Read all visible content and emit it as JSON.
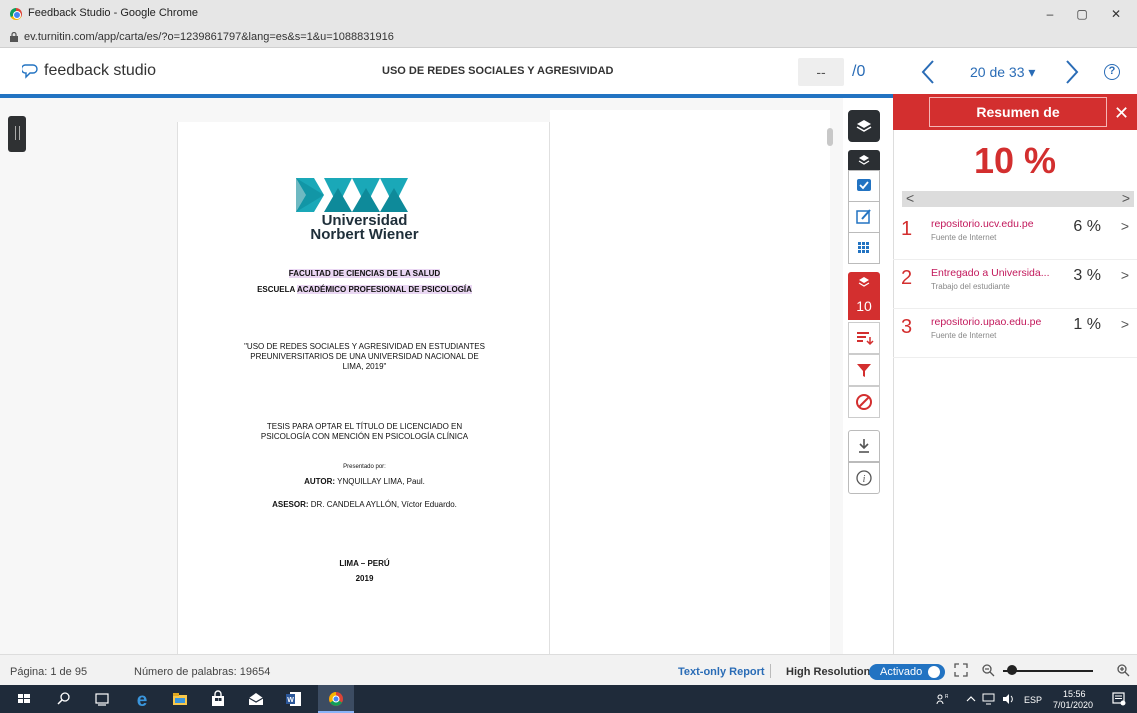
{
  "browser": {
    "window_title": "Feedback Studio - Google Chrome",
    "url": "ev.turnitin.com/app/carta/es/?o=1239861797&lang=es&s=1&u=1088831916",
    "minimize": "–",
    "maximize": "▢",
    "close": "✕"
  },
  "header": {
    "brand": "feedback studio",
    "document_title": "USO DE REDES SOCIALES Y AGRESIVIDAD",
    "page_input": "--",
    "page_total": "/0",
    "doc_counter": "20 de 33 ▾",
    "help": "?"
  },
  "document": {
    "university_line1": "Universidad",
    "university_line2": "Norbert Wiener",
    "faculty": "FACULTAD DE CIENCIAS DE LA SALUD",
    "school_a": "ESCUELA ",
    "school_b": "ACADÉMICO ",
    "school_c": "PROFESIONAL DE PSICOLOGÍA",
    "title_l1": "\"USO DE REDES SOCIALES Y AGRESIVIDAD EN ESTUDIANTES",
    "title_l2": "PREUNIVERSITARIOS DE UNA UNIVERSIDAD NACIONAL DE",
    "title_l3": "LIMA, 2019\"",
    "thesis_l1": "TESIS PARA OPTAR EL TÍTULO DE LICENCIADO EN",
    "thesis_l2": "PSICOLOGÍA CON MENCIÓN EN PSICOLOGÍA CLÍNICA",
    "presented": "Presentado por:",
    "author_label": "AUTOR:",
    "author": " YNQUILLAY LIMA, Paul.",
    "advisor_label": "ASESOR:",
    "advisor": " DR. CANDELA AYLLÓN, Víctor Eduardo.",
    "city": "LIMA – PERÚ",
    "year": "2019"
  },
  "tools": {
    "similarity_count": "10"
  },
  "panel": {
    "title": "Resumen de coincidencias",
    "close": "✕",
    "percentage": "10 %",
    "scroll_left": "<",
    "scroll_right": ">",
    "matches": [
      {
        "num": "1",
        "source": "repositorio.ucv.edu.pe",
        "type": "Fuente de Internet",
        "pct": "6 %"
      },
      {
        "num": "2",
        "source": "Entregado a Universida...",
        "type": "Trabajo del estudiante",
        "pct": "3 %"
      },
      {
        "num": "3",
        "source": "repositorio.upao.edu.pe",
        "type": "Fuente de Internet",
        "pct": "1 %"
      }
    ],
    "arrow": ">"
  },
  "status": {
    "page": "Página: 1 de 95",
    "words": "Número de palabras: 19654",
    "text_only": "Text-only Report",
    "high_res": "High Resolution",
    "toggle": "Activado"
  },
  "taskbar": {
    "lang": "ESP",
    "time": "15:56",
    "date": "7/01/2020"
  },
  "colors": {
    "turnitin_red": "#d32f2f",
    "turnitin_blue": "#2273c2",
    "match_source": "#c2185b"
  }
}
